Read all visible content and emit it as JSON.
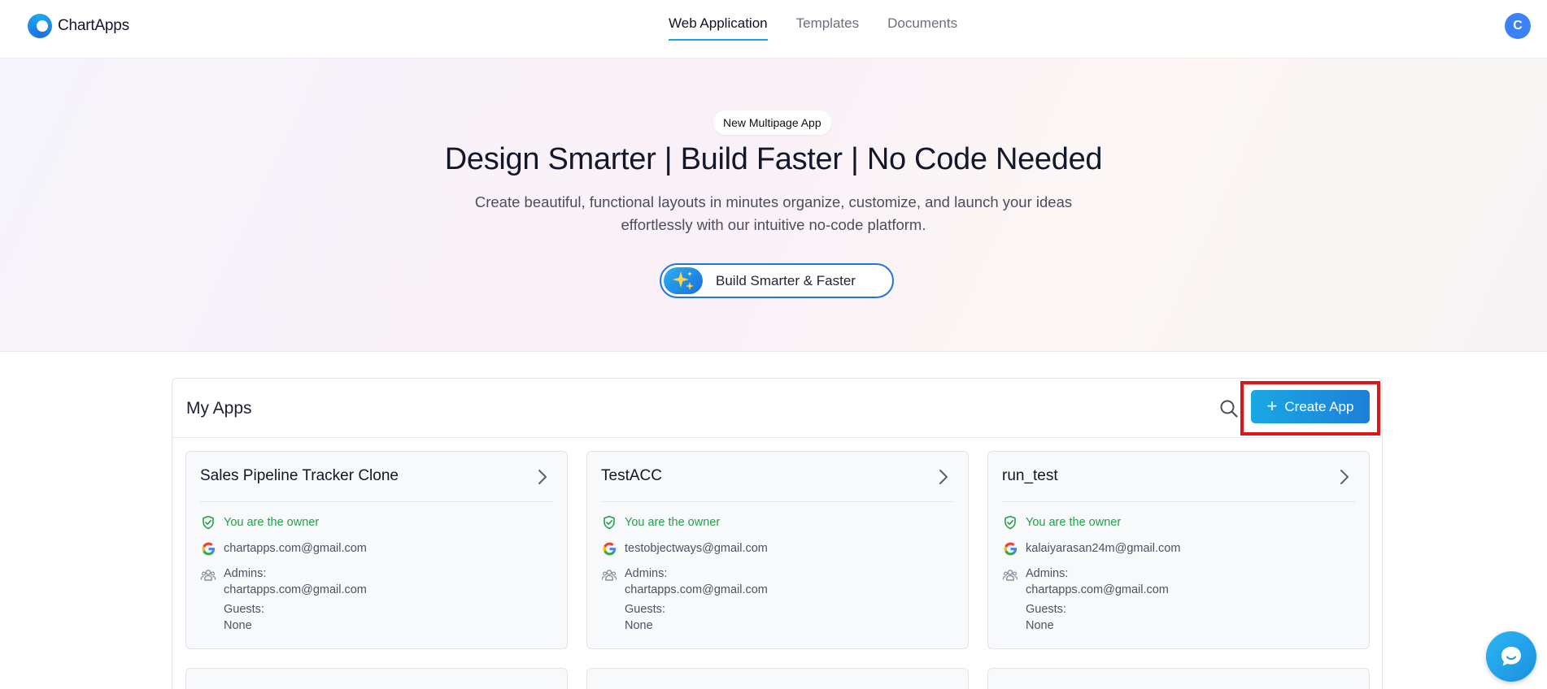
{
  "header": {
    "brand": "ChartApps",
    "tabs": [
      {
        "label": "Web Application",
        "active": true
      },
      {
        "label": "Templates",
        "active": false
      },
      {
        "label": "Documents",
        "active": false
      }
    ],
    "avatar_initial": "C"
  },
  "hero": {
    "badge": "New Multipage App",
    "title": "Design Smarter | Build Faster | No Code Needed",
    "subtitle_line1": "Create beautiful, functional layouts in minutes organize, customize, and launch your ideas",
    "subtitle_line2": "effortlessly with our intuitive no-code platform.",
    "cta_label": "Build Smarter & Faster"
  },
  "apps": {
    "title": "My Apps",
    "create_label": "Create App",
    "cards": [
      {
        "name": "Sales Pipeline Tracker Clone",
        "owner_text": "You are the owner",
        "email": "chartapps.com@gmail.com",
        "admins_label": "Admins:",
        "admins_value": "chartapps.com@gmail.com",
        "guests_label": "Guests:",
        "guests_value": "None"
      },
      {
        "name": "TestACC",
        "owner_text": "You are the owner",
        "email": "testobjectways@gmail.com",
        "admins_label": "Admins:",
        "admins_value": "chartapps.com@gmail.com",
        "guests_label": "Guests:",
        "guests_value": "None"
      },
      {
        "name": "run_test",
        "owner_text": "You are the owner",
        "email": "kalaiyarasan24m@gmail.com",
        "admins_label": "Admins:",
        "admins_value": "chartapps.com@gmail.com",
        "guests_label": "Guests:",
        "guests_value": "None"
      }
    ]
  },
  "colors": {
    "accent": "#1ea1e8",
    "owner_green": "#23a04a",
    "highlight_red": "#e0141b"
  }
}
